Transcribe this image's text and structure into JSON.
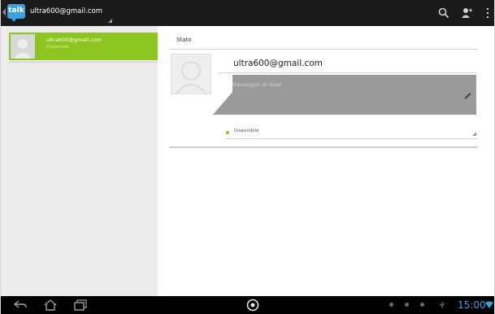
{
  "action_bar": {
    "app_icon_label": "talk",
    "account": "ultra600@gmail.com",
    "icons": [
      "back-caret",
      "search-icon",
      "add-user-icon",
      "overflow-menu-icon"
    ]
  },
  "contact_list": {
    "items": [
      {
        "name": "ultra600@gmail.com",
        "status": "Disponibile",
        "selected": true
      }
    ],
    "accent": "#8cc51f"
  },
  "detail": {
    "section_title": "Stato",
    "email": "ultra600@gmail.com",
    "status_message_placeholder": "Messaggio di stato",
    "status_value": "Disponibile",
    "status_color": "#8cc51f"
  },
  "system_bar": {
    "clock": "15:00",
    "clock_color": "#3aa0de",
    "icons": [
      "back-icon",
      "home-icon",
      "recent-apps-icon",
      "center-app-icon",
      "notification-icons",
      "wifi-icon"
    ]
  }
}
